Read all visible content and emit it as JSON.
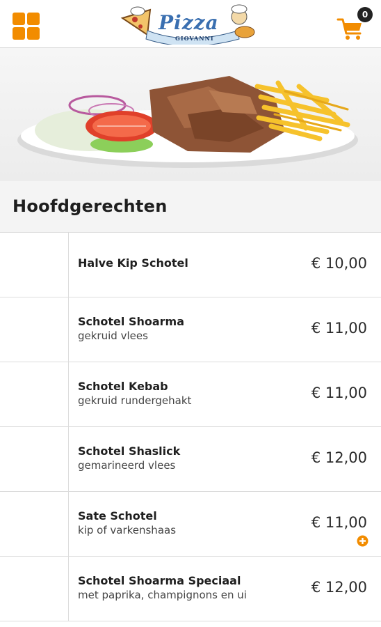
{
  "header": {
    "logo_text": "Pizza",
    "logo_sub": "GIOVANNI",
    "cart_count": "0"
  },
  "colors": {
    "accent": "#f28c00",
    "text": "#1a1a1a",
    "divider": "#dcdcdc"
  },
  "section": {
    "title": "Hoofdgerechten"
  },
  "items": [
    {
      "name": "Halve Kip Schotel",
      "desc": "",
      "price": "€ 10,00"
    },
    {
      "name": "Schotel Shoarma",
      "desc": "gekruid vlees",
      "price": "€ 11,00"
    },
    {
      "name": "Schotel Kebab",
      "desc": "gekruid rundergehakt",
      "price": "€ 11,00"
    },
    {
      "name": "Schotel Shaslick",
      "desc": "gemarineerd vlees",
      "price": "€ 12,00"
    },
    {
      "name": "Sate Schotel",
      "desc": "kip of varkenshaas",
      "price": "€ 11,00"
    },
    {
      "name": "Schotel Shoarma Speciaal",
      "desc": "met paprika, champignons en ui",
      "price": "€ 12,00"
    }
  ]
}
